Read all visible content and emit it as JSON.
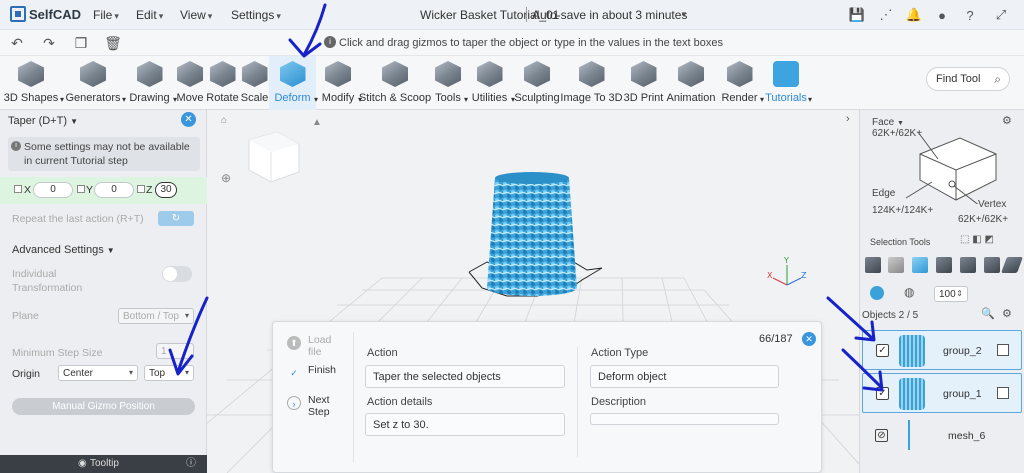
{
  "app": {
    "name": "SelfCAD"
  },
  "menu": [
    "File",
    "Edit",
    "View",
    "Settings"
  ],
  "document": {
    "title": "Wicker Basket Tutorial_01",
    "autosave": "Auto-save in about 3 minutes"
  },
  "hint": "Click and drag gizmos to taper the object or type in the values in the text boxes",
  "toolbar": {
    "tools": [
      {
        "label": "3D Shapes",
        "dropdown": true
      },
      {
        "label": "Generators",
        "dropdown": true
      },
      {
        "label": "Drawing",
        "dropdown": true
      },
      {
        "label": "Move",
        "dropdown": false
      },
      {
        "label": "Rotate",
        "dropdown": false
      },
      {
        "label": "Scale",
        "dropdown": false
      },
      {
        "label": "Deform",
        "dropdown": true
      },
      {
        "label": "Modify",
        "dropdown": true
      },
      {
        "label": "Stitch & Scoop",
        "dropdown": false
      },
      {
        "label": "Tools",
        "dropdown": true
      },
      {
        "label": "Utilities",
        "dropdown": true
      },
      {
        "label": "Sculpting",
        "dropdown": false
      },
      {
        "label": "Image To 3D",
        "dropdown": false
      },
      {
        "label": "3D Print",
        "dropdown": false
      },
      {
        "label": "Animation",
        "dropdown": false
      },
      {
        "label": "Render",
        "dropdown": true
      },
      {
        "label": "Tutorials",
        "dropdown": true
      }
    ],
    "active_tool": "Deform",
    "find_tool": "Find Tool"
  },
  "left_panel": {
    "title": "Taper (D+T)",
    "warning": "Some settings may not be available in current Tutorial step",
    "x_label": "X",
    "x_value": "0",
    "y_label": "Y",
    "y_value": "0",
    "z_label": "Z",
    "z_value": "30",
    "repeat_label": "Repeat the last action (R+T)",
    "advanced_settings": "Advanced Settings",
    "individual_transformation": "Individual Transformation",
    "plane_label": "Plane",
    "plane_value": "Bottom / Top",
    "min_step_label": "Minimum Step Size",
    "min_step_value": "1",
    "origin_label": "Origin",
    "origin_value": "Center",
    "origin_side": "Top",
    "gizmo_button": "Manual Gizmo Position",
    "tooltip": "Tooltip"
  },
  "tutorial_dialog": {
    "steps": [
      {
        "label": "Load file",
        "state": "disabled"
      },
      {
        "label": "Finish",
        "state": "done"
      },
      {
        "label": "Next Step",
        "state": "next"
      }
    ],
    "counter": "66/187",
    "action_label": "Action",
    "action_value": "Taper the selected objects",
    "action_type_label": "Action Type",
    "action_type_value": "Deform object",
    "action_details_label": "Action details",
    "action_details_value": "Set z to 30.",
    "description_label": "Description",
    "description_value": ""
  },
  "right_panel": {
    "face_label": "Face",
    "face_count": "62K+/62K+",
    "edge_label": "Edge",
    "edge_count": "124K+/124K+",
    "vertex_label": "Vertex",
    "vertex_count": "62K+/62K+",
    "selection_tools": "Selection Tools",
    "brush_size": "100",
    "objects_header": "Objects 2 / 5",
    "objects": [
      {
        "name": "group_2",
        "checked": true,
        "selected": true
      },
      {
        "name": "group_1",
        "checked": true,
        "selected": true
      },
      {
        "name": "mesh_6",
        "checked": false,
        "selected": false
      }
    ]
  },
  "colors": {
    "accent": "#2d8ad6",
    "annotation": "#1722c8",
    "model": "#3aa2d8"
  }
}
